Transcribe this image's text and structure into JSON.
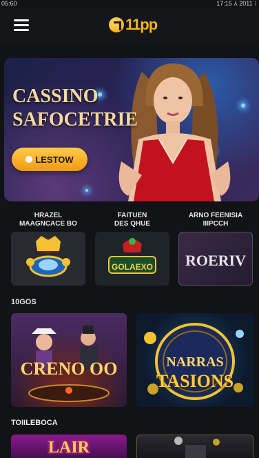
{
  "status": {
    "time": "05:60",
    "right": "17:15 ⅄ 2011 ⁝"
  },
  "brand": {
    "logo_text": "11pp"
  },
  "hero": {
    "title_line1": "CASSINO",
    "title_line2": "SAFOCETRIE",
    "cta_label": "LESTOW"
  },
  "categories": [
    {
      "label_line1": "HRAZEL",
      "label_line2": "MAAGNCACE BO",
      "card_text": ""
    },
    {
      "label_line1": "FAITUEN",
      "label_line2": "DES QHUE",
      "card_text": "GOLAEXO"
    },
    {
      "label_line1": "ARNO FEENISIA",
      "label_line2": "IIIPCCH",
      "card_text": "ROERIV"
    }
  ],
  "sections": {
    "games_title": "10GOS",
    "second_title": "TOIILEBOCA"
  },
  "games": [
    {
      "name": "CRENO OO"
    },
    {
      "name_line1": "NARRAS",
      "name_line2": "TASIONS"
    }
  ],
  "bottom_cards": [
    {
      "name": "LAIR"
    },
    {
      "name": ""
    }
  ],
  "colors": {
    "accent": "#f5b51a",
    "background": "#121317",
    "hero_text": "#f3d99a"
  }
}
